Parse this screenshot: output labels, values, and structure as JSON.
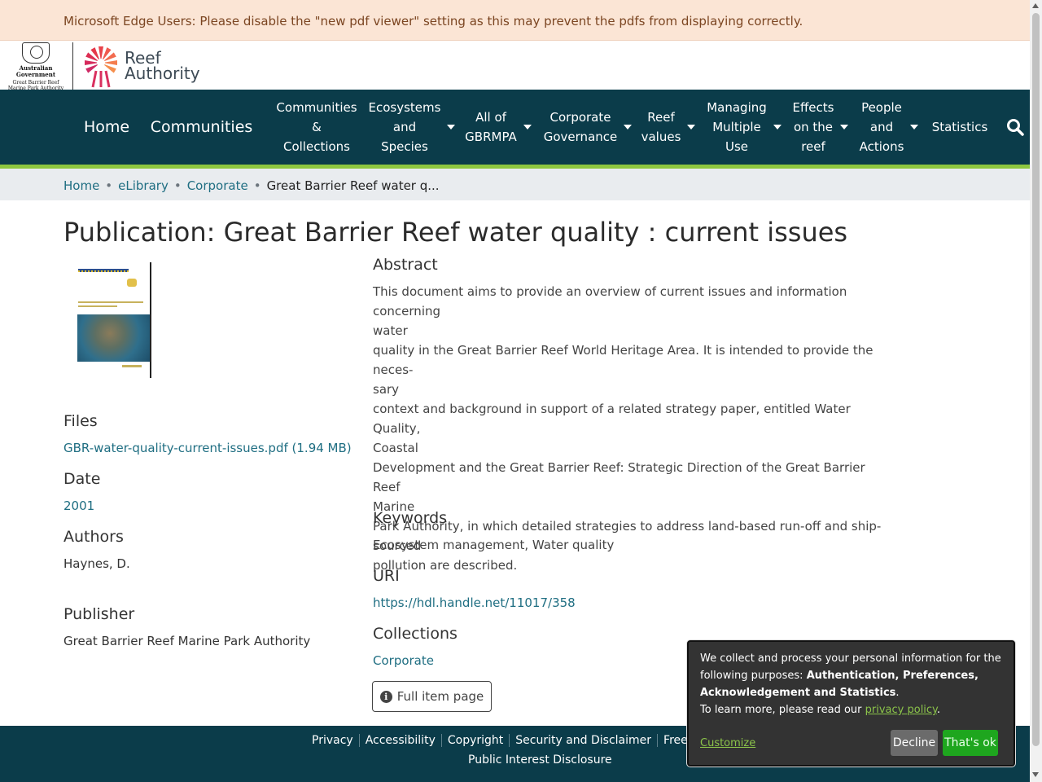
{
  "alert": {
    "text": "Microsoft Edge Users: Please disable the \"new pdf viewer\" setting as this may prevent the pdfs from displaying correctly."
  },
  "logos": {
    "gov_line1": "Australian Government",
    "gov_line2": "Great Barrier Reef",
    "gov_line3": "Marine Park Authority",
    "reef_word1": "Reef",
    "reef_word2": "Authority"
  },
  "nav": {
    "home": "Home",
    "communities": "Communities",
    "communities_collections": [
      "Communities",
      "&",
      "Collections"
    ],
    "ecosystems": [
      "Ecosystems",
      "and",
      "Species"
    ],
    "all_of": [
      "All of",
      "GBRMPA"
    ],
    "corporate": [
      "Corporate",
      "Governance"
    ],
    "reef_values": [
      "Reef",
      "values"
    ],
    "managing": [
      "Managing",
      "Multiple",
      "Use"
    ],
    "effects": [
      "Effects",
      "on the",
      "reef"
    ],
    "people": [
      "People",
      "and",
      "Actions"
    ],
    "statistics": "Statistics"
  },
  "breadcrumb": {
    "home": "Home",
    "elibrary": "eLibrary",
    "corporate": "Corporate",
    "current": "Great Barrier Reef water q..."
  },
  "page": {
    "title": "Publication: Great Barrier Reef water quality : current issues"
  },
  "sidebar": {
    "files_heading": "Files",
    "file_link": "GBR-water-quality-current-issues.pdf (1.94 MB)",
    "date_heading": "Date",
    "date_value": "2001",
    "authors_heading": "Authors",
    "authors_value": "Haynes, D.",
    "publisher_heading": "Publisher",
    "publisher_value": "Great Barrier Reef Marine Park Authority"
  },
  "main": {
    "abstract_heading": "Abstract",
    "abstract_lines": [
      "This document aims to provide an overview of current issues and information concerning",
      "water",
      "quality in the Great Barrier Reef World Heritage Area. It is intended to provide the neces-",
      "sary",
      "context and background in support of a related strategy paper, entitled Water Quality,",
      "Coastal",
      "Development and the Great Barrier Reef: Strategic Direction of the Great Barrier Reef",
      "Marine",
      "Park Authority, in which detailed strategies to address land-based run-off and ship-",
      "sourced",
      "pollution are described."
    ],
    "keywords_heading": "Keywords",
    "keywords_value": "Ecosystem management, Water quality",
    "uri_heading": "URI",
    "uri_value": "https://hdl.handle.net/11017/358",
    "collections_heading": "Collections",
    "collections_value": "Corporate",
    "full_item_button": "Full item page"
  },
  "footer": {
    "links": [
      "Privacy",
      "Accessibility",
      "Copyright",
      "Security and Disclaimer",
      "Freedom of"
    ],
    "second_line": "Public Interest Disclosure"
  },
  "cookie": {
    "text1": "We collect and process your personal information for the following purposes: ",
    "purposes": "Authentication, Preferences, Acknowledgement and Statistics",
    "text2_end": ".",
    "learn_more": "To learn more, please read our ",
    "policy_link": "privacy policy",
    "period": ".",
    "customize": "Customize",
    "decline": "Decline",
    "ok": "That's ok"
  },
  "icons": {
    "search": "search-icon",
    "info": "info-icon",
    "caret": "caret-down-icon"
  },
  "colors": {
    "nav_bg": "#0b3c4a",
    "accent_green": "#8dc63f",
    "link": "#1f6e82",
    "alert_bg": "#fbe5d5",
    "ok_button": "#1ea61e"
  }
}
